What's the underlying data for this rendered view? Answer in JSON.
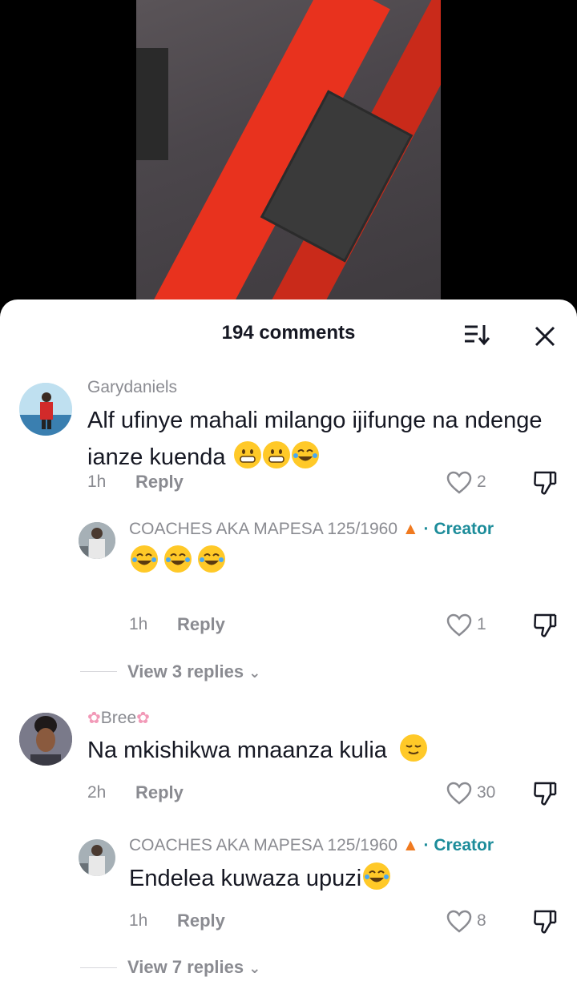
{
  "header": {
    "count_label": "194 comments"
  },
  "comments": [
    {
      "username": "Garydaniels",
      "text": "Alf ufinye mahali milango ijifunge na ndenge ianze kuenda",
      "time": "1h",
      "reply_label": "Reply",
      "likes": "2",
      "reply": {
        "username": "COACHES AKA MAPESA 125/1960",
        "badge": "· Creator",
        "text": "",
        "time": "1h",
        "reply_label": "Reply",
        "likes": "1"
      },
      "view_replies": "View 3 replies"
    },
    {
      "username": "Bree",
      "text": "Na mkishikwa mnaanza kulia",
      "time": "2h",
      "reply_label": "Reply",
      "likes": "30",
      "reply": {
        "username": "COACHES AKA MAPESA 125/1960",
        "badge": "· Creator",
        "text": "Endelea kuwaza upuzi",
        "time": "1h",
        "reply_label": "Reply",
        "likes": "8"
      },
      "view_replies": "View 7 replies"
    }
  ],
  "icons": {
    "sort": "sort-icon",
    "close": "close-icon",
    "like": "heart-outline-icon",
    "dislike": "thumbs-down-icon",
    "fire": "fire-emoji-icon"
  },
  "colors": {
    "creator": "#1c8c9a",
    "muted": "#8a8b91",
    "text": "#161823"
  }
}
